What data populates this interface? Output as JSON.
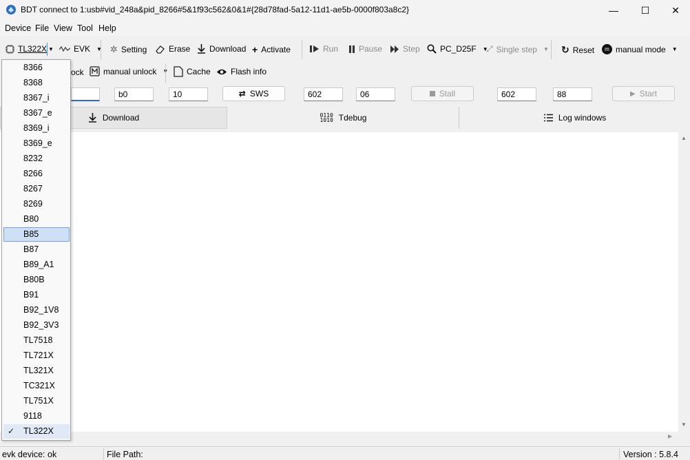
{
  "window": {
    "title": "BDT connect to 1:usb#vid_248a&pid_8266#5&1f93c562&0&1#{28d78fad-5a12-11d1-ae5b-0000f803a8c2}",
    "minimize": "—",
    "maximize": "☐",
    "close": "✕"
  },
  "menu": [
    "Device",
    "File",
    "View",
    "Tool",
    "Help"
  ],
  "toolbar1": {
    "chip": "TL322X",
    "evk": "EVK",
    "setting": "Setting",
    "erase": "Erase",
    "download": "Download",
    "activate": "Activate",
    "run": "Run",
    "pause": "Pause",
    "step": "Step",
    "pc": "PC_D25F",
    "single_step": "Single step",
    "reset": "Reset",
    "mode": "manual mode"
  },
  "toolbar2": {
    "unlock_partial": "ock",
    "manual_unlock": "manual unlock",
    "cache": "Cache",
    "flash_info": "Flash info"
  },
  "fields": {
    "f1": "",
    "f2": "b0",
    "f3": "10",
    "sws": "SWS",
    "f4": "602",
    "f5": "06",
    "stall": "Stall",
    "f6": "602",
    "f7": "88",
    "start": "Start"
  },
  "tabs": {
    "download": "Download",
    "tdebug": "Tdebug",
    "log": "Log windows"
  },
  "dropdown": {
    "items": [
      "8366",
      "8368",
      "8367_i",
      "8367_e",
      "8369_i",
      "8369_e",
      "8232",
      "8266",
      "8267",
      "8269",
      "B80",
      "B85",
      "B87",
      "B89_A1",
      "B80B",
      "B91",
      "B92_1V8",
      "B92_3V3",
      "TL7518",
      "TL721X",
      "TL321X",
      "TC321X",
      "TL751X",
      "9118",
      "TL322X"
    ],
    "highlighted": "B85",
    "checked": "TL322X"
  },
  "status": {
    "device": "evk device: ok",
    "file_path": "File Path:",
    "version": "Version : 5.8.4"
  }
}
